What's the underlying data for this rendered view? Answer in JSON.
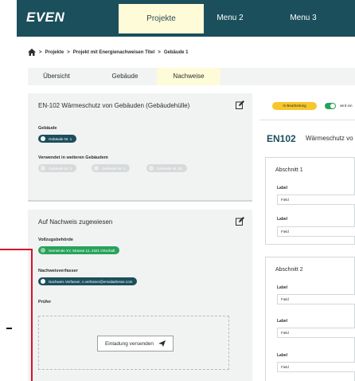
{
  "topbar": {
    "logo": "EVEN",
    "nav": [
      "Projekte",
      "Menu 2",
      "Menu 3"
    ]
  },
  "breadcrumb": {
    "items": [
      "Projekte",
      "Projekt mit Energienachweisen Titel",
      "Gebäude 1"
    ],
    "separator": ">"
  },
  "subtabs": [
    "Übersicht",
    "Gebäude",
    "Nachweise"
  ],
  "card1": {
    "title": "EN-102 Wärmeschutz von Gebäuden (Gebäudehülle)",
    "building_label": "Gebäude",
    "building_pill": "Gebäude Nr. 1",
    "used_in_label": "Verwendet in weiteren Gebäudem",
    "used_in_pills": [
      "Gebäude Nr. 2",
      "Gebäude Nr. 3",
      "Gebäude Nr. 33"
    ]
  },
  "card2": {
    "title": "Auf Nachweis zugewiesen",
    "authority_label": "Vollzugsbehörde",
    "authority_pill": "Gemeinde XY, Strasse 12, 4321 Ortschaft",
    "author_label": "Nachweisverfasser",
    "author_pill": "Nachweis Verfasser, n.verfasser@emailadresse.com",
    "checker_label": "Prüfer",
    "invite_button": "Einladung versenden"
  },
  "right": {
    "status": "In Bearbeitung",
    "toggle_label": "wird ein",
    "code": "EN102",
    "title": "Wärmeschutz vo",
    "sections": [
      {
        "title": "Abschnitt 1",
        "fields": [
          {
            "label": "Label",
            "value": "Field"
          },
          {
            "label": "Label",
            "value": "Field"
          }
        ]
      },
      {
        "title": "Abschnitt 2",
        "fields": [
          {
            "label": "Label",
            "value": "Field"
          },
          {
            "label": "Label",
            "value": "Field"
          },
          {
            "label": "Label",
            "value": "Field"
          }
        ]
      }
    ]
  },
  "colors": {
    "brand": "#1b4f5c",
    "highlight": "#fefbd8",
    "success": "#27a35b",
    "warning": "#f6c62b",
    "annotation": "#d3122b"
  },
  "icons": {
    "home": "home-icon",
    "edit": "edit-icon",
    "building": "building-icon",
    "authority": "building-icon",
    "person": "person-icon",
    "send": "send-icon"
  }
}
